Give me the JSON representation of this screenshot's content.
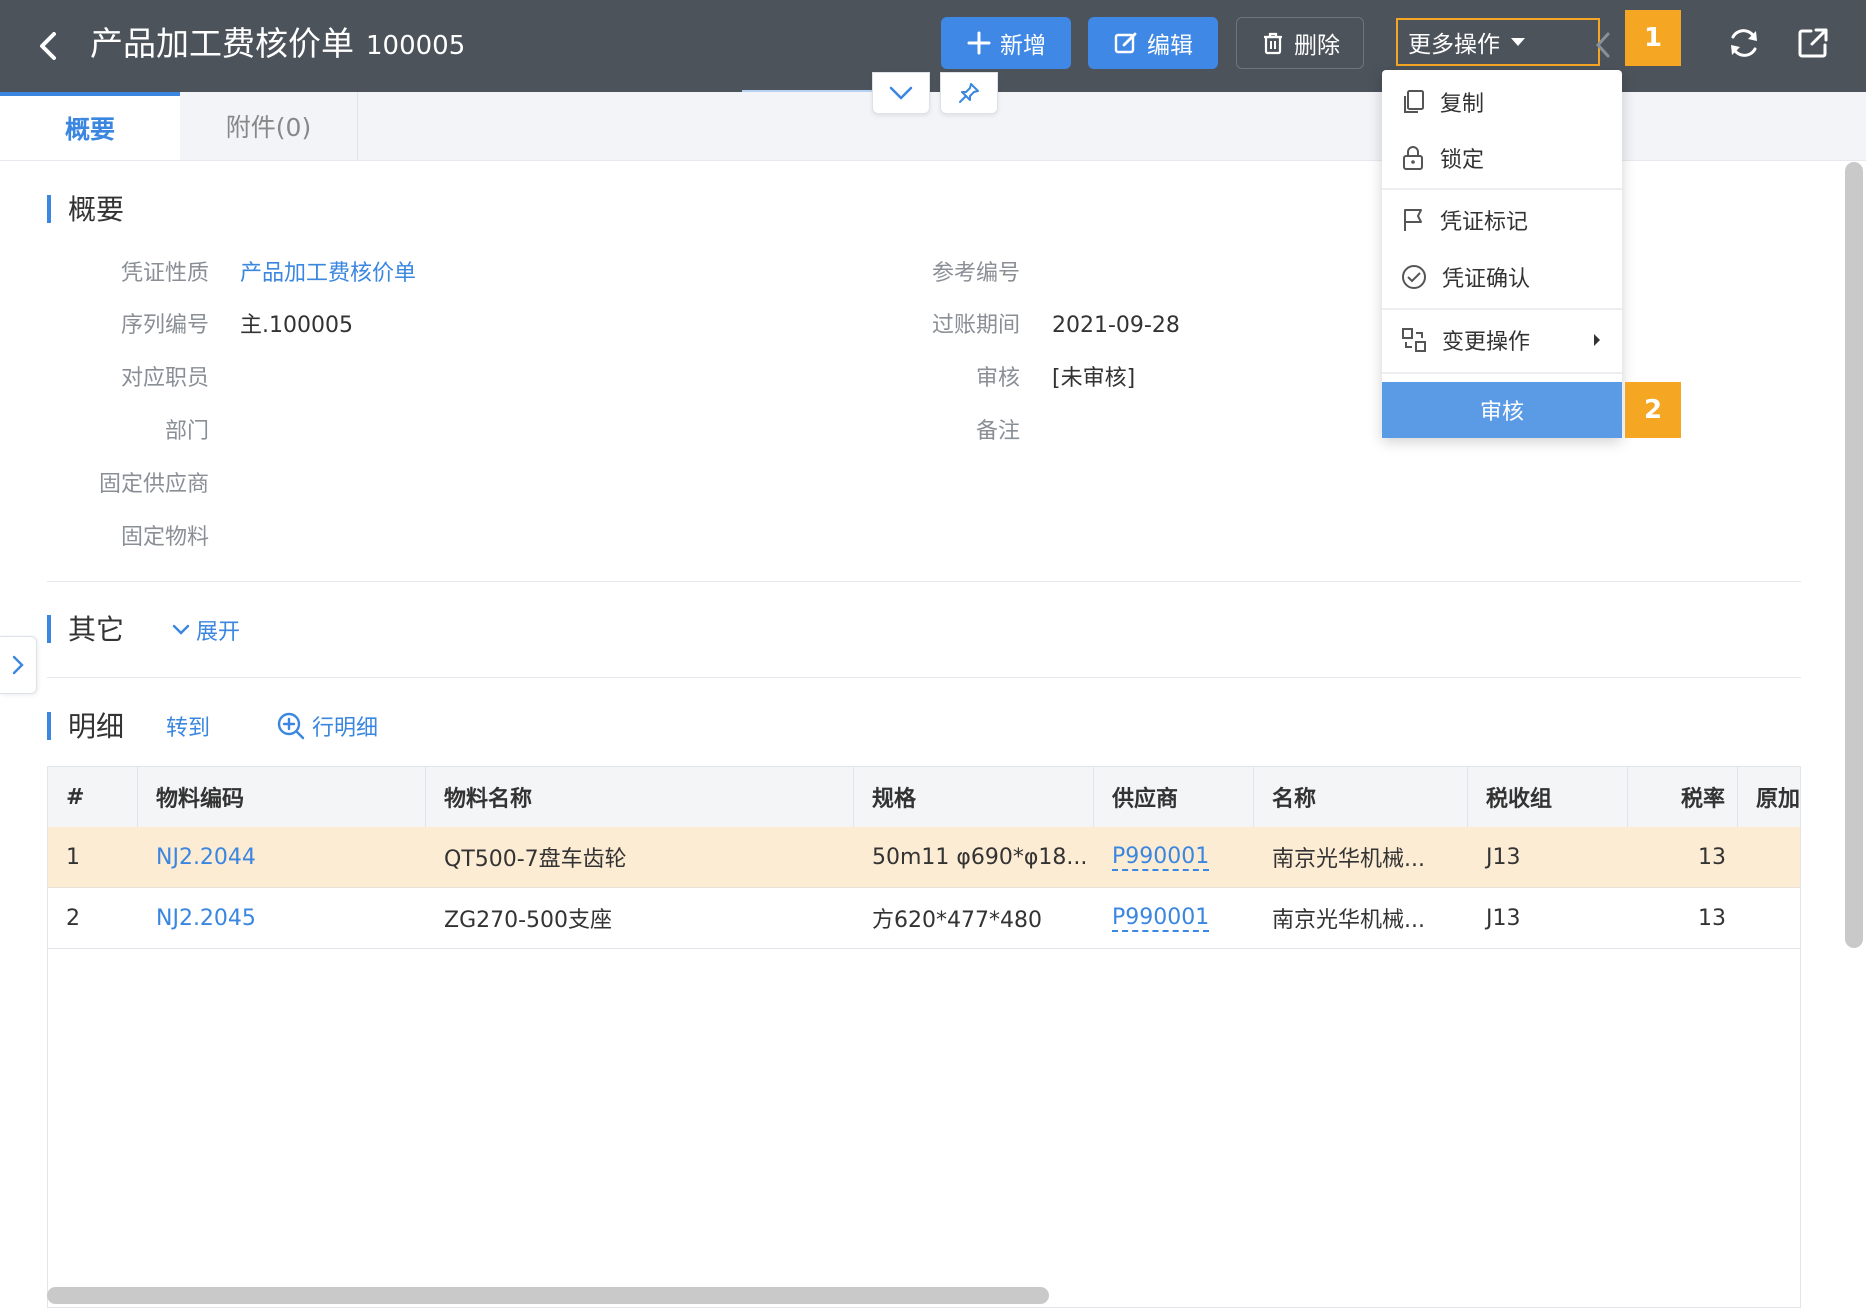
{
  "header": {
    "title": "产品加工费核价单",
    "doc_no": "100005",
    "buttons": {
      "add": "新增",
      "edit": "编辑",
      "delete": "删除",
      "more": "更多操作"
    },
    "badges": [
      "1",
      "2"
    ]
  },
  "tabs": [
    {
      "label": "概要"
    },
    {
      "label": "附件(0)"
    }
  ],
  "summary": {
    "title": "概要",
    "fields_left": [
      {
        "label": "凭证性质",
        "value": "产品加工费核价单"
      },
      {
        "label": "序列编号",
        "value": "主.100005"
      },
      {
        "label": "对应职员",
        "value": ""
      },
      {
        "label": "部门",
        "value": ""
      },
      {
        "label": "固定供应商",
        "value": ""
      },
      {
        "label": "固定物料",
        "value": ""
      }
    ],
    "fields_right": [
      {
        "label": "参考编号",
        "value": ""
      },
      {
        "label": "过账期间",
        "value": "2021-09-28"
      },
      {
        "label": "审核",
        "value": "[未审核]"
      },
      {
        "label": "备注",
        "value": ""
      }
    ]
  },
  "other": {
    "title": "其它",
    "expand_label": "展开"
  },
  "detail": {
    "title": "明细",
    "transfer_label": "转到",
    "row_detail_label": "行明细",
    "columns": [
      "#",
      "物料编码",
      "物料名称",
      "规格",
      "供应商",
      "名称",
      "税收组",
      "税率",
      "原加工"
    ],
    "rows": [
      {
        "no": "1",
        "code": "NJ2.2044",
        "name": "QT500-7盘车齿轮",
        "spec": "50m11 φ690*φ18...",
        "supplier": "P990001",
        "sname": "南京光华机械...",
        "tax_group": "J13",
        "tax_rate": "13"
      },
      {
        "no": "2",
        "code": "NJ2.2045",
        "name": "ZG270-500支座",
        "spec": "方620*477*480",
        "supplier": "P990001",
        "sname": "南京光华机械...",
        "tax_group": "J13",
        "tax_rate": "13"
      }
    ]
  },
  "menu": {
    "items": [
      {
        "label": "复制",
        "icon": "copy-icon"
      },
      {
        "label": "锁定",
        "icon": "lock-icon"
      },
      {
        "label": "凭证标记",
        "icon": "flag-icon"
      },
      {
        "label": "凭证确认",
        "icon": "check-circle-icon"
      },
      {
        "label": "变更操作",
        "icon": "change-icon"
      }
    ],
    "highlight": "审核"
  },
  "colors": {
    "header_bg": "#4d535b",
    "primary": "#3f88e5",
    "accent": "#3a86e0",
    "badge": "#f5a623",
    "row_highlight": "#fdecd4"
  }
}
